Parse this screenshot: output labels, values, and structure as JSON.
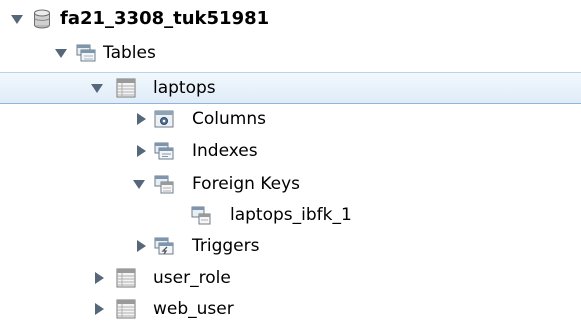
{
  "tree": {
    "database": {
      "label": "fa21_3308_tuk51981",
      "icon": "database-icon"
    },
    "tables_folder": {
      "label": "Tables",
      "icon": "folder-icon"
    },
    "laptops": {
      "label": "laptops",
      "icon": "table-icon",
      "selected": true,
      "children": {
        "columns": {
          "label": "Columns",
          "icon": "columns-icon"
        },
        "indexes": {
          "label": "Indexes",
          "icon": "indexes-icon"
        },
        "foreign_keys": {
          "label": "Foreign Keys",
          "icon": "foreign-keys-icon",
          "children": [
            {
              "label": "laptops_ibfk_1",
              "icon": "foreign-key-icon"
            }
          ]
        },
        "triggers": {
          "label": "Triggers",
          "icon": "triggers-icon"
        }
      }
    },
    "other_tables": [
      {
        "label": "user_role",
        "icon": "table-icon"
      },
      {
        "label": "web_user",
        "icon": "table-icon"
      }
    ]
  },
  "colors": {
    "selection_background": "#dfecf8",
    "selection_border": "#8fb5de",
    "twisty": "#556778"
  }
}
